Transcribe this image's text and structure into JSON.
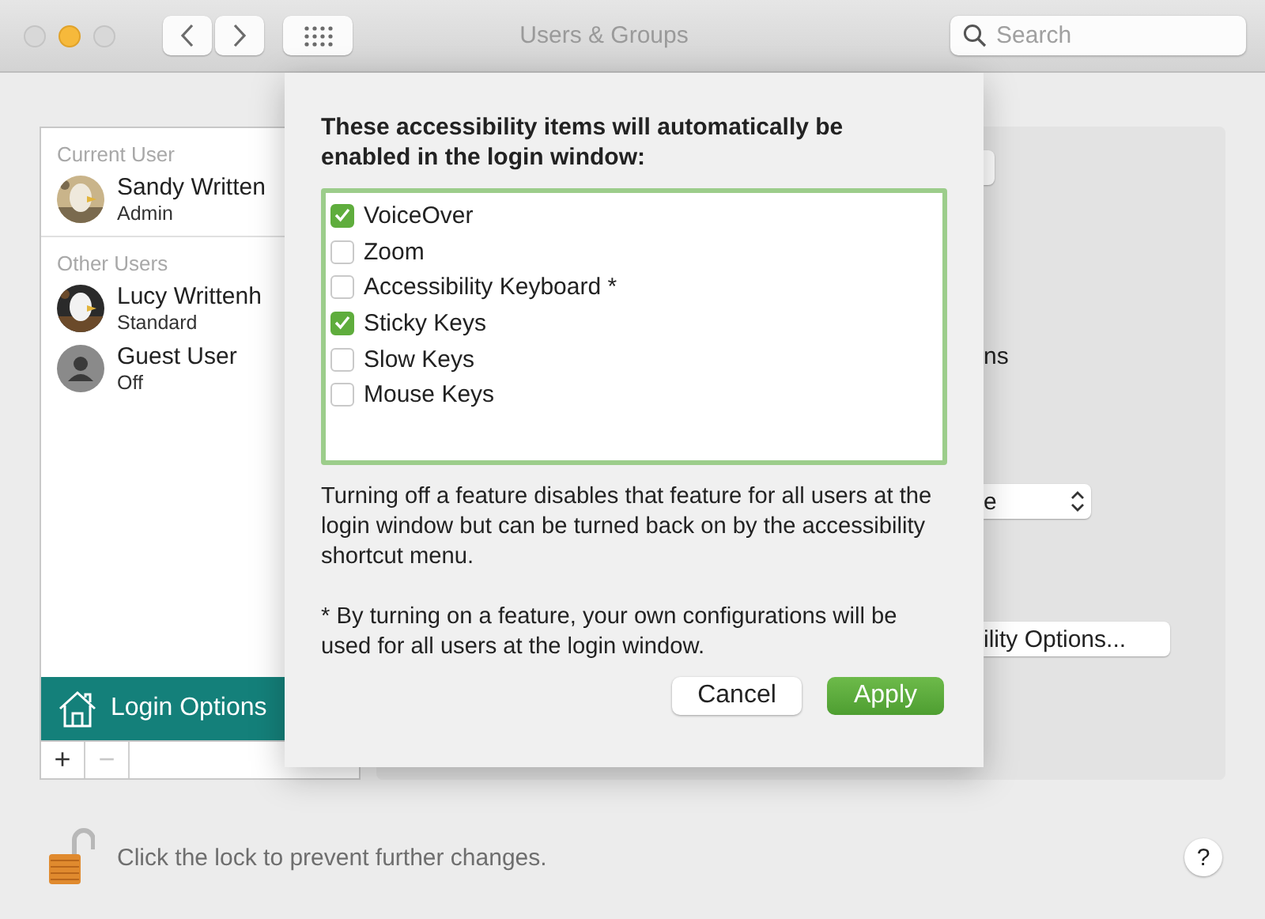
{
  "window": {
    "title": "Users & Groups"
  },
  "search": {
    "placeholder": "Search"
  },
  "sidebar": {
    "sections": [
      {
        "heading": "Current User",
        "users": [
          {
            "name": "Sandy Written",
            "role": "Admin",
            "kind": "picture"
          }
        ]
      },
      {
        "heading": "Other Users",
        "users": [
          {
            "name": "Lucy Writtenh",
            "role": "Standard",
            "kind": "picture"
          },
          {
            "name": "Guest User",
            "role": "Off",
            "kind": "guest"
          }
        ]
      }
    ],
    "login_options": {
      "label": "Login Options",
      "selected": true
    },
    "add": "+",
    "remove": "−",
    "remove_disabled": true
  },
  "background_panel": {
    "label": "ns",
    "popup_value": "e",
    "button": "ility Options..."
  },
  "sheet": {
    "heading": "These accessibility items will automatically be enabled in the login window:",
    "items": [
      {
        "label": "VoiceOver",
        "checked": true
      },
      {
        "label": "Zoom",
        "checked": false
      },
      {
        "label": "Accessibility Keyboard *",
        "checked": false
      },
      {
        "label": "Sticky Keys",
        "checked": true
      },
      {
        "label": "Slow Keys",
        "checked": false
      },
      {
        "label": "Mouse Keys",
        "checked": false
      }
    ],
    "note": "Turning off a feature disables that feature for all users at the login window but can be turned back on by the accessibility shortcut menu.",
    "footnote": "* By turning on a feature, your own configurations will be used for all users at the login window.",
    "buttons": [
      {
        "label": "Cancel",
        "kind": "normal"
      },
      {
        "label": "Apply",
        "kind": "default"
      }
    ]
  },
  "footer": {
    "lock_text": "Click the lock to prevent further changes.",
    "help": "?"
  }
}
